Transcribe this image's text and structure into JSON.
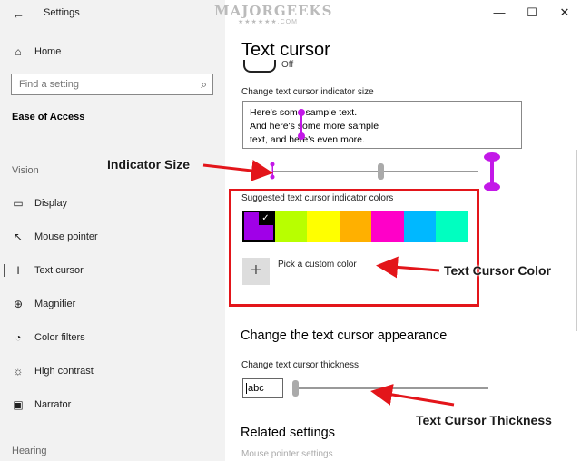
{
  "window": {
    "app_title": "Settings",
    "controls": {
      "minimize": "—",
      "maximize": "☐",
      "close": "✕"
    }
  },
  "watermark": {
    "text": "MAJORGEEKS",
    "sub": "★★★★★★.COM"
  },
  "sidebar": {
    "home": "Home",
    "search_placeholder": "Find a setting",
    "section": "Ease of Access",
    "group_vision": "Vision",
    "items": [
      {
        "label": "Display",
        "icon": "monitor-icon"
      },
      {
        "label": "Mouse pointer",
        "icon": "mouse-pointer-icon"
      },
      {
        "label": "Text cursor",
        "icon": "text-cursor-icon"
      },
      {
        "label": "Magnifier",
        "icon": "magnifier-icon"
      },
      {
        "label": "Color filters",
        "icon": "palette-icon"
      },
      {
        "label": "High contrast",
        "icon": "sun-icon"
      },
      {
        "label": "Narrator",
        "icon": "narrator-icon"
      }
    ],
    "group_hearing": "Hearing"
  },
  "main": {
    "page_title": "Text cursor",
    "toggle_state": "Off",
    "indicator_size_label": "Change text cursor indicator size",
    "sample_lines": [
      "Here's some sample text.",
      "And here's some more sample",
      "text, and here's even more."
    ],
    "colors_label": "Suggested text cursor indicator colors",
    "swatches": [
      "#a000e8",
      "#b8ff00",
      "#ffff00",
      "#ffb000",
      "#ff00c8",
      "#00b8ff",
      "#00ffc0"
    ],
    "selected_swatch": 0,
    "custom_color_label": "Pick a custom color",
    "appearance_heading": "Change the text cursor appearance",
    "thickness_label": "Change text cursor thickness",
    "thickness_preview": "abc",
    "related_heading": "Related settings",
    "related_link": "Mouse pointer settings"
  },
  "annotations": {
    "indicator_size": "Indicator Size",
    "text_cursor_color": "Text Cursor Color",
    "text_cursor_thickness": "Text Cursor Thickness",
    "accent_color": "#e3151a",
    "indicator_color": "#c318e8"
  }
}
